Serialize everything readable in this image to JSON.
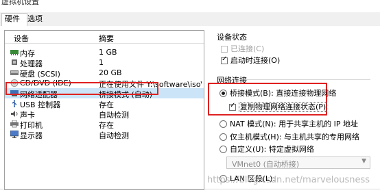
{
  "window": {
    "title": "虚拟机设置"
  },
  "tabs": [
    {
      "label": "硬件"
    },
    {
      "label": "选项"
    }
  ],
  "device_list": {
    "headers": {
      "device": "设备",
      "summary": "摘要"
    },
    "rows": [
      {
        "name": "内存",
        "summary": "1 GB",
        "icon": "memory-icon"
      },
      {
        "name": "处理器",
        "summary": "1",
        "icon": "processor-icon"
      },
      {
        "name": "硬盘 (SCSI)",
        "summary": "20 GB",
        "icon": "hard-disk-icon"
      },
      {
        "name": "CD/DVD (IDE)",
        "summary": "正在使用文件 Y:\\software\\iso\\...",
        "icon": "cd-dvd-icon"
      },
      {
        "name": "网络适配器",
        "summary": "桥接模式 (自动)",
        "icon": "network-adapter-icon",
        "selected": true
      },
      {
        "name": "USB 控制器",
        "summary": "存在",
        "icon": "usb-icon"
      },
      {
        "name": "声卡",
        "summary": "自动检测",
        "icon": "sound-card-icon"
      },
      {
        "name": "打印机",
        "summary": "存在",
        "icon": "printer-icon"
      },
      {
        "name": "显示器",
        "summary": "自动检测",
        "icon": "display-icon"
      }
    ]
  },
  "device_status": {
    "title": "设备状态",
    "connected": {
      "label": "已连接(C)",
      "checked": false,
      "enabled": false
    },
    "connect_on_power": {
      "label": "启动时连接(O)",
      "checked": true
    }
  },
  "network_connection": {
    "title": "网络连接",
    "bridged": {
      "label": "桥接模式(B): 直接连接物理网络",
      "selected": true
    },
    "replicate": {
      "label": "复制物理网络连接状态(P)",
      "checked": true
    },
    "nat": {
      "label": "NAT 模式(N): 用于共享主机的 IP 地址",
      "selected": false
    },
    "host_only": {
      "label": "仅主机模式(H): 与主机共享的专用网络",
      "selected": false
    },
    "custom": {
      "label": "自定义(U): 特定虚拟网络",
      "selected": false
    },
    "vmnet_select": {
      "value": "VMnet0 (自动桥接)"
    },
    "lan_segment": {
      "label": "LAN 区段(L):",
      "selected": false
    }
  },
  "watermark": {
    "text": "https://blog.csdn.net/marvelousness"
  },
  "colors": {
    "highlight_box": "#e02020",
    "selection": "#cce4f7"
  }
}
